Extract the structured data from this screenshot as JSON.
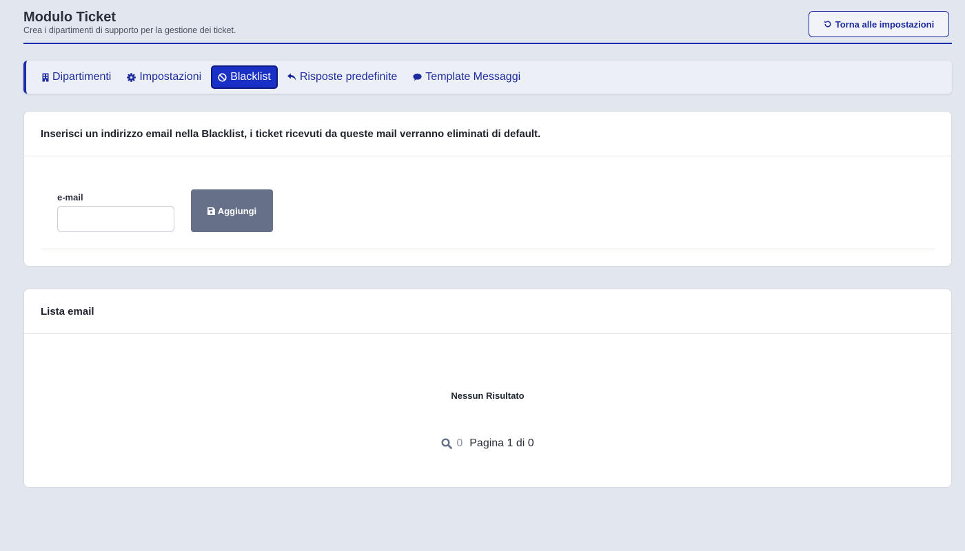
{
  "header": {
    "title": "Modulo Ticket",
    "subtitle": "Crea i dipartimenti di supporto per la gestione dei ticket.",
    "back_button": "Torna alle impostazioni"
  },
  "tabs": [
    {
      "label": "Dipartimenti",
      "icon": "building-icon",
      "active": false
    },
    {
      "label": "Impostazioni",
      "icon": "gear-icon",
      "active": false
    },
    {
      "label": "Blacklist",
      "icon": "ban-icon",
      "active": true
    },
    {
      "label": "Risposte predefinite",
      "icon": "reply-icon",
      "active": false
    },
    {
      "label": "Template Messaggi",
      "icon": "chat-icon",
      "active": false
    }
  ],
  "blacklist_card": {
    "heading": "Inserisci un indirizzo email nella Blacklist, i ticket ricevuti da queste mail verranno eliminati di default.",
    "email_label": "e-mail",
    "email_value": "",
    "add_button": "Aggiungi"
  },
  "list_card": {
    "heading": "Lista email",
    "empty_text": "Nessun Risultato",
    "result_count": "0",
    "page_text": "Pagina 1 di 0"
  },
  "colors": {
    "accent": "#1d2b9f",
    "active_tab": "#1930c6",
    "button_gray": "#667089",
    "background": "#e2e6ee"
  }
}
